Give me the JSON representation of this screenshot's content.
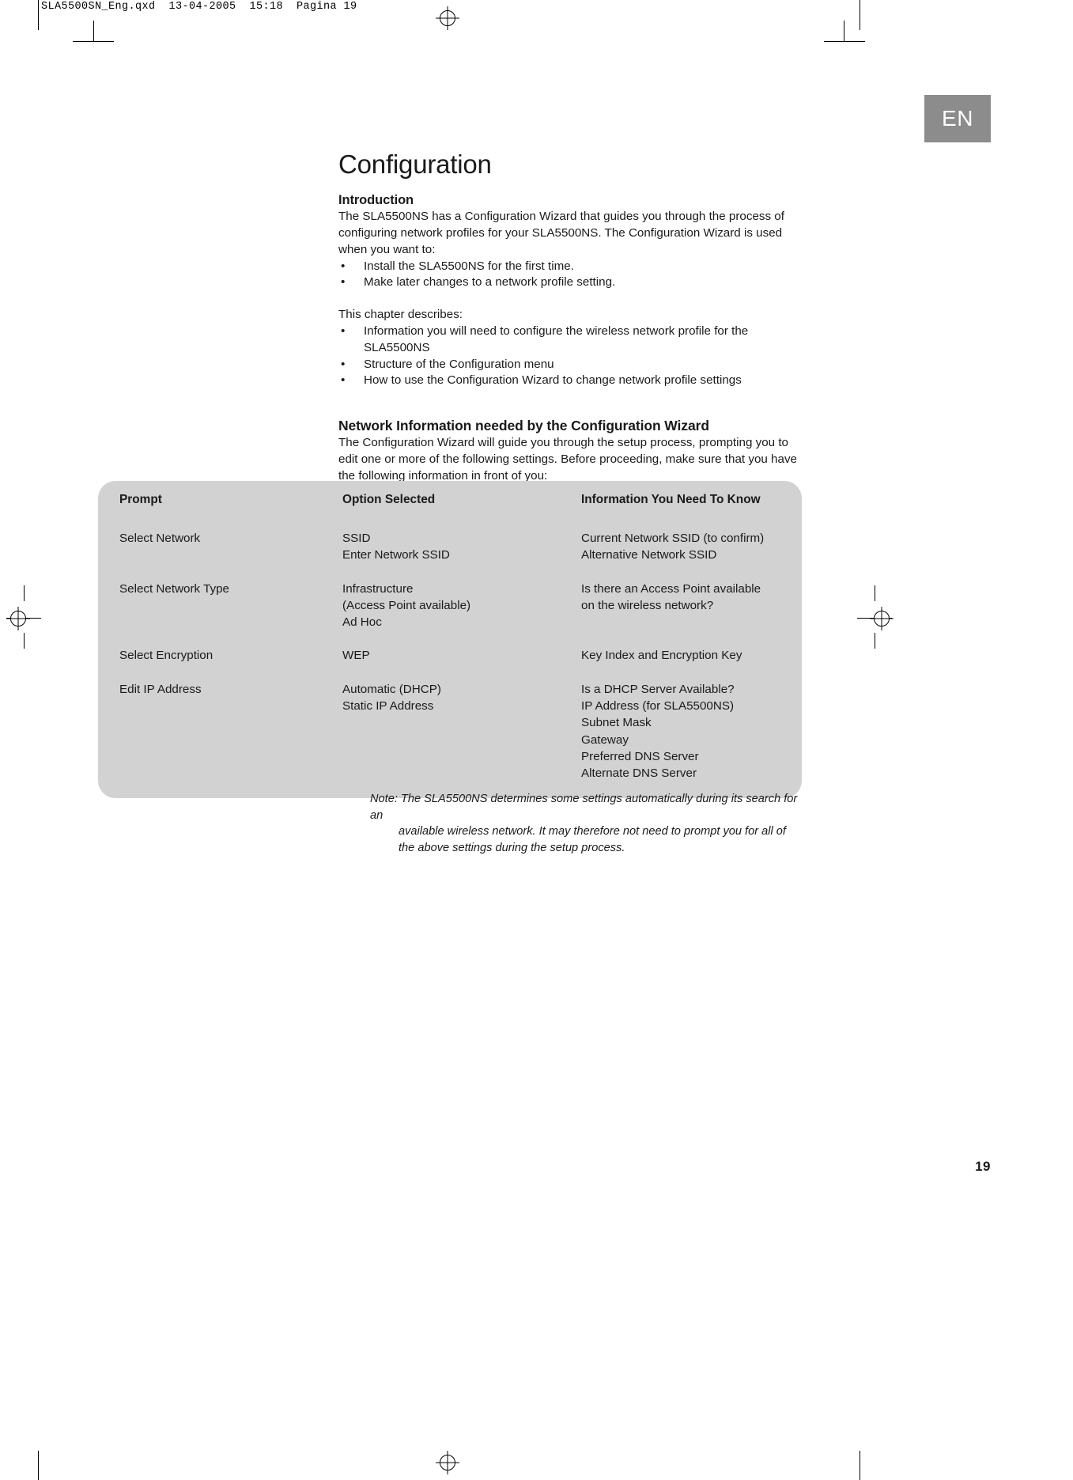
{
  "file_stamp": "SLA5500SN_Eng.qxd  13-04-2005  15:18  Pagina 19",
  "language_tab": "EN",
  "page_number": "19",
  "title": "Configuration",
  "introduction": {
    "heading": "Introduction",
    "paragraph": "The SLA5500NS has a Configuration Wizard that guides you through the process of configuring network profiles for your SLA5500NS. The Configuration Wizard is used when you want to:",
    "bullets": [
      "Install the SLA5500NS for the first time.",
      "Make later changes to a network profile setting."
    ],
    "chapter_lead": "This chapter describes:",
    "chapter_bullets": [
      "Information you will need to configure the wireless network profile for the SLA5500NS",
      "Structure of the Configuration menu",
      "How to use the Configuration Wizard to change network profile settings"
    ]
  },
  "network_info": {
    "heading": "Network Information needed by the Configuration Wizard",
    "paragraph": "The Configuration Wizard will guide you through the setup process, prompting you to edit one or more of the following settings. Before proceeding, make sure that you have the following information in front of you:"
  },
  "table": {
    "columns": [
      "Prompt",
      "Option Selected",
      "Information You Need To Know"
    ],
    "rows": [
      {
        "prompt": [
          "Select Network"
        ],
        "options": [
          "SSID",
          "Enter Network SSID"
        ],
        "info": [
          "Current Network SSID (to confirm)",
          "Alternative Network SSID"
        ]
      },
      {
        "prompt": [
          "Select Network Type"
        ],
        "options": [
          "Infrastructure",
          "(Access Point available)",
          "Ad Hoc"
        ],
        "info": [
          "Is there an Access Point available",
          "on the wireless network?"
        ]
      },
      {
        "prompt": [
          "Select Encryption"
        ],
        "options": [
          "WEP"
        ],
        "info": [
          "Key Index and Encryption Key"
        ]
      },
      {
        "prompt": [
          "Edit IP Address"
        ],
        "options": [
          "Automatic (DHCP)",
          "Static IP Address"
        ],
        "info": [
          "Is a DHCP Server Available?",
          "IP Address (for SLA5500NS)",
          "Subnet Mask",
          "Gateway",
          "Preferred DNS Server",
          "Alternate DNS Server"
        ]
      }
    ]
  },
  "note": {
    "line1": "Note: The SLA5500NS determines some settings automatically during its search for an",
    "line2": "available wireless network. It may therefore not need to prompt you for all of",
    "line3": "the above settings during the setup process."
  },
  "colors": {
    "table_panel": "#d2d2d2",
    "lang_tab": "#8c8c8c",
    "text": "#1a1a1a"
  }
}
